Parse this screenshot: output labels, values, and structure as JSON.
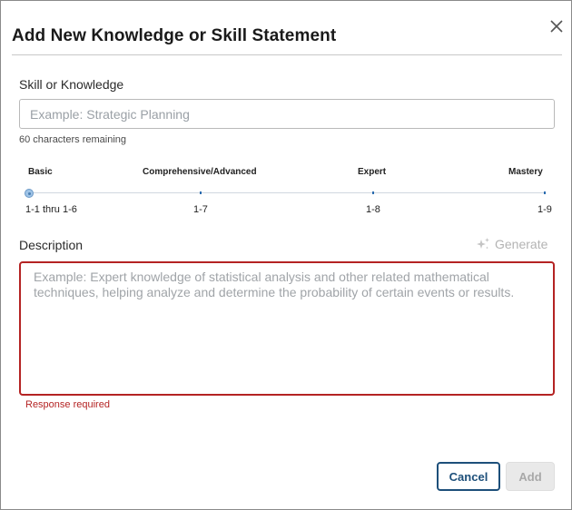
{
  "dialog": {
    "title": "Add New Knowledge or Skill Statement",
    "close_icon": "close-icon"
  },
  "skill": {
    "label": "Skill or Knowledge",
    "value": "",
    "placeholder": "Example: Strategic Planning",
    "remaining": "60 characters remaining"
  },
  "proficiency": {
    "levels": [
      {
        "name": "Basic",
        "range": "1-1 thru 1-6"
      },
      {
        "name": "Comprehensive/Advanced",
        "range": "1-7"
      },
      {
        "name": "Expert",
        "range": "1-8"
      },
      {
        "name": "Mastery",
        "range": "1-9"
      }
    ],
    "selected_level": "Basic"
  },
  "description": {
    "label": "Description",
    "generate_label": "Generate",
    "generate_icon": "sparkle-icon",
    "value": "",
    "placeholder": "Example: Expert knowledge of statistical analysis and other related mathematical techniques, helping analyze and determine the probability of certain events or results.",
    "error": "Response required"
  },
  "actions": {
    "cancel_label": "Cancel",
    "add_label": "Add"
  },
  "colors": {
    "error": "#b42323",
    "primary": "#1d4f7a",
    "disabled": "#e9e9e9"
  }
}
